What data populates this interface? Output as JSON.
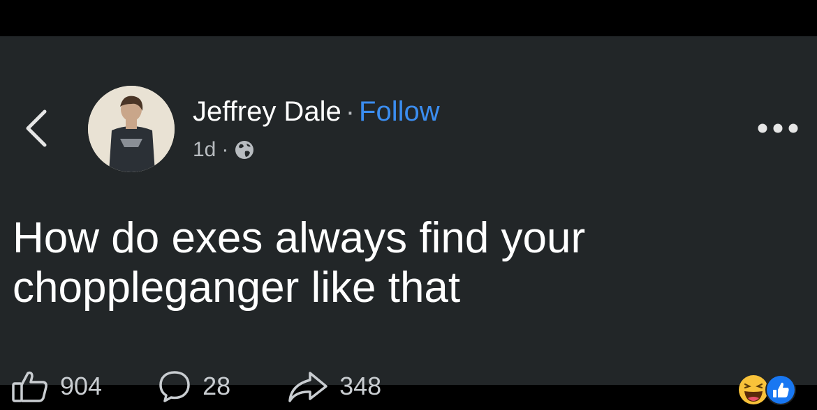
{
  "author": {
    "name": "Jeffrey Dale",
    "separator": "·",
    "follow_label": "Follow"
  },
  "meta": {
    "time": "1d",
    "separator": "·",
    "audience_icon": "globe-icon"
  },
  "post": {
    "text": "How do exes always find your choppleganger like that"
  },
  "actions": {
    "likes": "904",
    "comments": "28",
    "shares": "348"
  },
  "reactions": [
    "laughing-emoji",
    "like-emoji"
  ],
  "colors": {
    "background": "#222628",
    "follow": "#3b8df0",
    "like_blue": "#1877f2"
  }
}
